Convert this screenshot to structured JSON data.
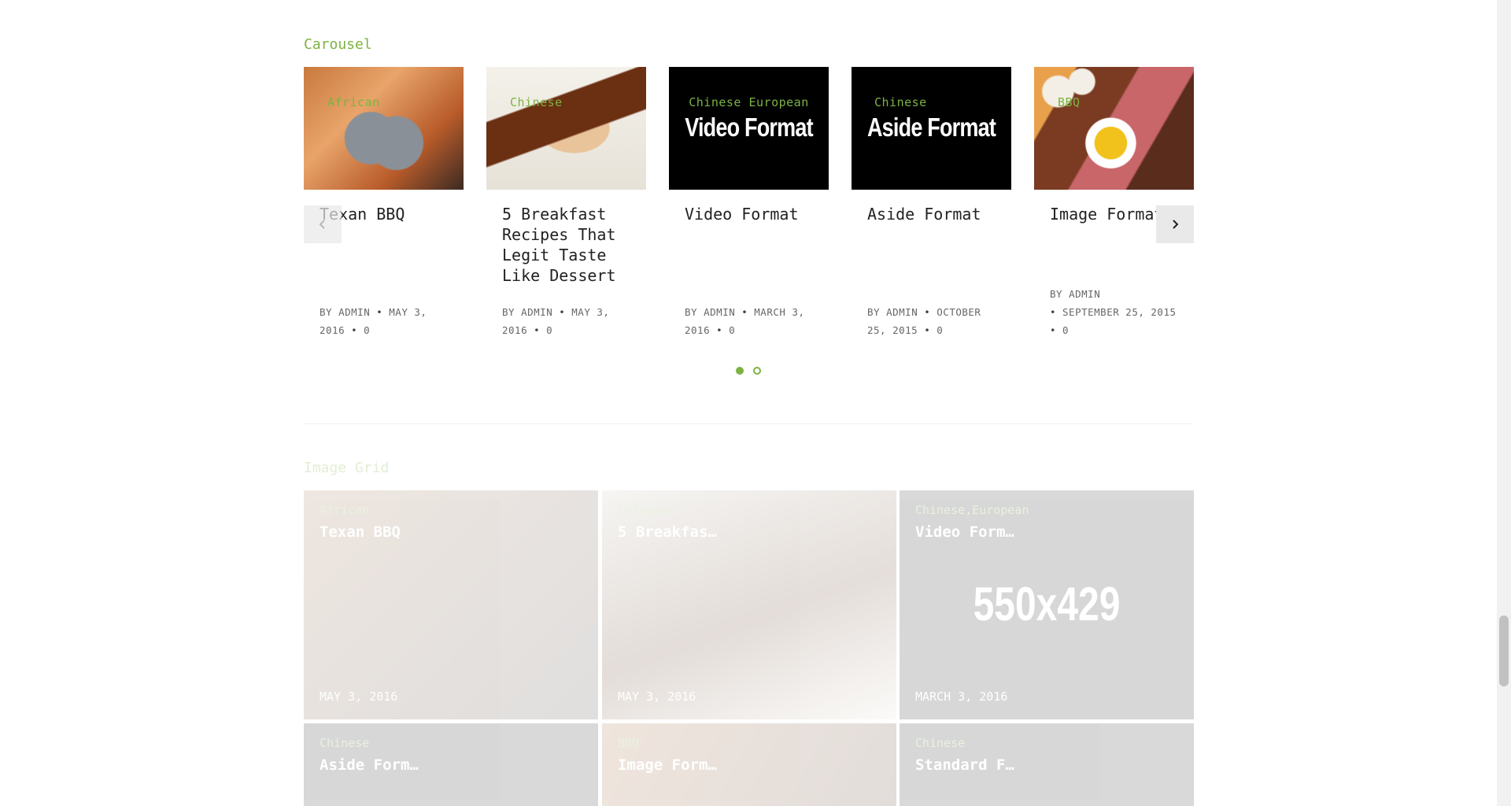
{
  "carousel": {
    "title": "Carousel",
    "cards": [
      {
        "category": "African",
        "title": "Texan BBQ",
        "by": "BY",
        "author": "ADMIN",
        "date": "MAY 3, 2016",
        "comments": "0"
      },
      {
        "category": "Chinese",
        "title": "5 Breakfast Recipes That Legit Taste Like Dessert",
        "by": "BY",
        "author": "ADMIN",
        "date": "MAY 3, 2016",
        "comments": "0"
      },
      {
        "category": "Chinese European",
        "format_label": "Video Format",
        "title": "Video Format",
        "by": "BY",
        "author": "ADMIN",
        "date": "MARCH 3, 2016",
        "comments": "0"
      },
      {
        "category": "Chinese",
        "format_label": "Aside Format",
        "title": "Aside Format",
        "by": "BY",
        "author": "ADMIN",
        "date": "OCTOBER 25, 2015",
        "comments": "0"
      },
      {
        "category": "BBQ",
        "title": "Image Format",
        "by": "BY",
        "author": "ADMIN",
        "date": "SEPTEMBER 25, 2015",
        "comments": "0"
      }
    ],
    "prev_icon": "chevron-left-icon",
    "next_icon": "chevron-right-icon",
    "pagination": {
      "pages": 2,
      "active": 1
    }
  },
  "image_grid": {
    "title": "Image Grid",
    "tiles": [
      {
        "category": "African",
        "title": "Texan BBQ",
        "date": "MAY 3, 2016"
      },
      {
        "category": "Chinese",
        "title": "5 Breakfas…",
        "date": "MAY 3, 2016"
      },
      {
        "category": "Chinese,European",
        "title": "Video Form…",
        "date": "MARCH 3, 2016",
        "placeholder": "550x429"
      },
      {
        "category": "Chinese",
        "title": "Aside Form…"
      },
      {
        "category": "BBQ",
        "title": "Image Form…"
      },
      {
        "category": "Chinese",
        "title": "Standard F…"
      }
    ]
  },
  "colors": {
    "accent": "#7cb342",
    "text": "#222222",
    "meta": "#666666"
  }
}
